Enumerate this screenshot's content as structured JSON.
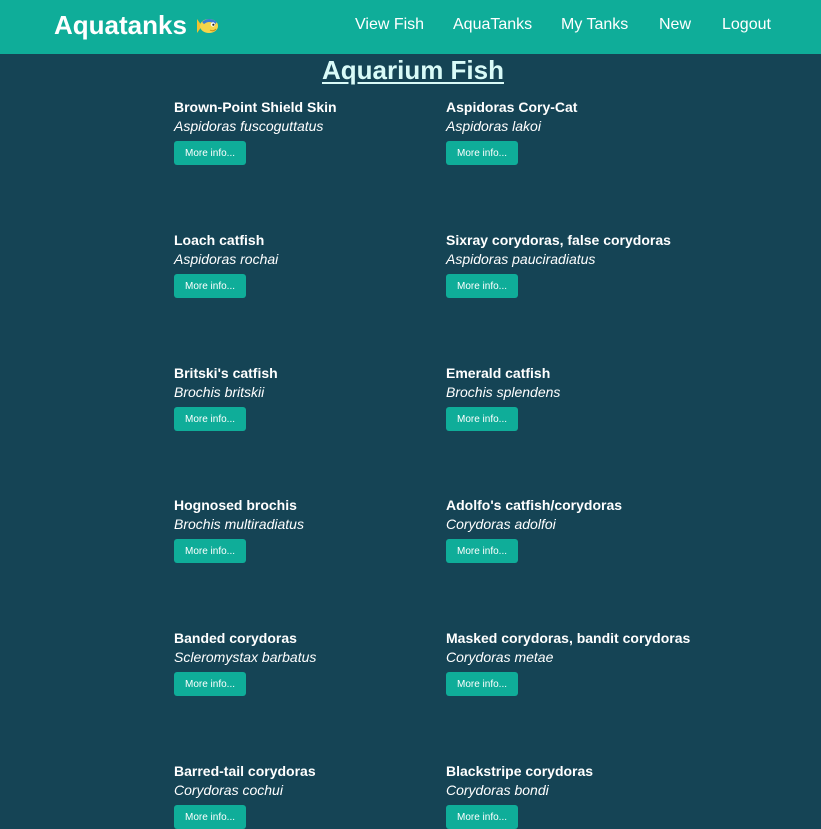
{
  "nav": {
    "brand": "Aquatanks",
    "links": [
      "View Fish",
      "AquaTanks",
      "My Tanks",
      "New",
      "Logout"
    ]
  },
  "page": {
    "title": "Aquarium Fish",
    "button_label": "More info..."
  },
  "fish": [
    {
      "common": "Brown-Point Shield Skin",
      "scientific": "Aspidoras fuscoguttatus"
    },
    {
      "common": "Aspidoras Cory-Cat",
      "scientific": "Aspidoras lakoi"
    },
    {
      "common": "Loach catfish",
      "scientific": "Aspidoras rochai"
    },
    {
      "common": "Sixray corydoras, false corydoras",
      "scientific": "Aspidoras pauciradiatus"
    },
    {
      "common": "Britski's catfish",
      "scientific": "Brochis britskii"
    },
    {
      "common": "Emerald catfish",
      "scientific": "Brochis splendens"
    },
    {
      "common": "Hognosed brochis",
      "scientific": "Brochis multiradiatus"
    },
    {
      "common": "Adolfo's catfish/corydoras",
      "scientific": "Corydoras adolfoi"
    },
    {
      "common": "Banded corydoras",
      "scientific": "Scleromystax barbatus"
    },
    {
      "common": "Masked corydoras, bandit corydoras",
      "scientific": "Corydoras metae"
    },
    {
      "common": "Barred-tail corydoras",
      "scientific": "Corydoras cochui"
    },
    {
      "common": "Blackstripe corydoras",
      "scientific": "Corydoras bondi"
    }
  ]
}
